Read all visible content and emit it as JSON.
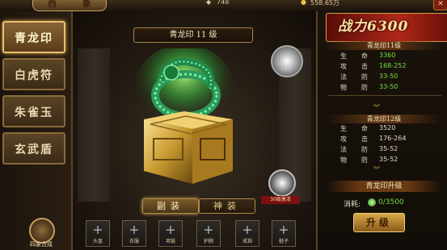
{
  "header": {
    "title": "西 象",
    "resource1": "748",
    "resource2": "558.65万",
    "close_icon": "✕"
  },
  "left_tabs": [
    {
      "label": "青龙印",
      "active": true
    },
    {
      "label": "白虎符",
      "active": false
    },
    {
      "label": "朱雀玉",
      "active": false
    },
    {
      "label": "玄武盾",
      "active": false
    }
  ],
  "combine_label": "四象合成",
  "center": {
    "seal_title": "青龙印   11 级",
    "lock_level": "Lv.0",
    "evolution_label": "30级激活",
    "bottom_tabs": [
      "副装",
      "神装"
    ],
    "slots": [
      "头盔",
      "衣服",
      "项链",
      "护腕",
      "戒指",
      "鞋子"
    ]
  },
  "right": {
    "power": "战力6300",
    "current": {
      "title": "青龙印11级",
      "stats": [
        {
          "k1": "生",
          "k2": "命",
          "v": "3360"
        },
        {
          "k1": "攻",
          "k2": "击",
          "v": "168-252"
        },
        {
          "k1": "法",
          "k2": "防",
          "v": "33-50"
        },
        {
          "k1": "物",
          "k2": "防",
          "v": "33-50"
        }
      ]
    },
    "next": {
      "title": "青龙印12级",
      "stats": [
        {
          "k1": "生",
          "k2": "命",
          "v": "3520"
        },
        {
          "k1": "攻",
          "k2": "击",
          "v": "176-264"
        },
        {
          "k1": "法",
          "k2": "防",
          "v": "35-52"
        },
        {
          "k1": "物",
          "k2": "防",
          "v": "35-52"
        }
      ]
    },
    "upgrade_title": "青龙印升级",
    "cost_label": "消耗:",
    "cost_value": "0/3500",
    "upgrade_button": "升级"
  },
  "colors": {
    "accent_gold": "#d8a848",
    "stat_green": "#70e040",
    "power_red": "#b02818"
  }
}
